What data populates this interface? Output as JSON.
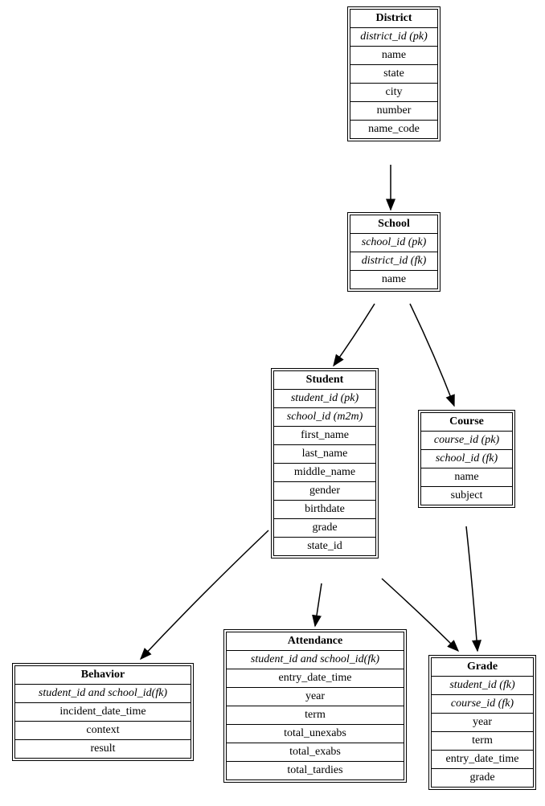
{
  "entities": {
    "district": {
      "title": "District",
      "fields": [
        {
          "label": "district_id (pk)",
          "key": true
        },
        {
          "label": "name"
        },
        {
          "label": "state"
        },
        {
          "label": "city"
        },
        {
          "label": "number"
        },
        {
          "label": "name_code"
        }
      ]
    },
    "school": {
      "title": "School",
      "fields": [
        {
          "label": "school_id (pk)",
          "key": true
        },
        {
          "label": "district_id (fk)",
          "key": true
        },
        {
          "label": "name"
        }
      ]
    },
    "student": {
      "title": "Student",
      "fields": [
        {
          "label": "student_id (pk)",
          "key": true
        },
        {
          "label": "school_id (m2m)",
          "key": true
        },
        {
          "label": "first_name"
        },
        {
          "label": "last_name"
        },
        {
          "label": "middle_name"
        },
        {
          "label": "gender"
        },
        {
          "label": "birthdate"
        },
        {
          "label": "grade"
        },
        {
          "label": "state_id"
        }
      ]
    },
    "course": {
      "title": "Course",
      "fields": [
        {
          "label": "course_id (pk)",
          "key": true
        },
        {
          "label": "school_id (fk)",
          "key": true
        },
        {
          "label": "name"
        },
        {
          "label": "subject"
        }
      ]
    },
    "behavior": {
      "title": "Behavior",
      "fields": [
        {
          "label": "student_id and school_id(fk)",
          "key": true
        },
        {
          "label": "incident_date_time"
        },
        {
          "label": "context"
        },
        {
          "label": "result"
        }
      ]
    },
    "attendance": {
      "title": "Attendance",
      "fields": [
        {
          "label": "student_id and school_id(fk)",
          "key": true
        },
        {
          "label": "entry_date_time"
        },
        {
          "label": "year"
        },
        {
          "label": "term"
        },
        {
          "label": "total_unexabs"
        },
        {
          "label": "total_exabs"
        },
        {
          "label": "total_tardies"
        }
      ]
    },
    "grade": {
      "title": "Grade",
      "fields": [
        {
          "label": "student_id (fk)",
          "key": true
        },
        {
          "label": "course_id (fk)",
          "key": true
        },
        {
          "label": "year"
        },
        {
          "label": "term"
        },
        {
          "label": "entry_date_time"
        },
        {
          "label": "grade"
        }
      ]
    }
  }
}
